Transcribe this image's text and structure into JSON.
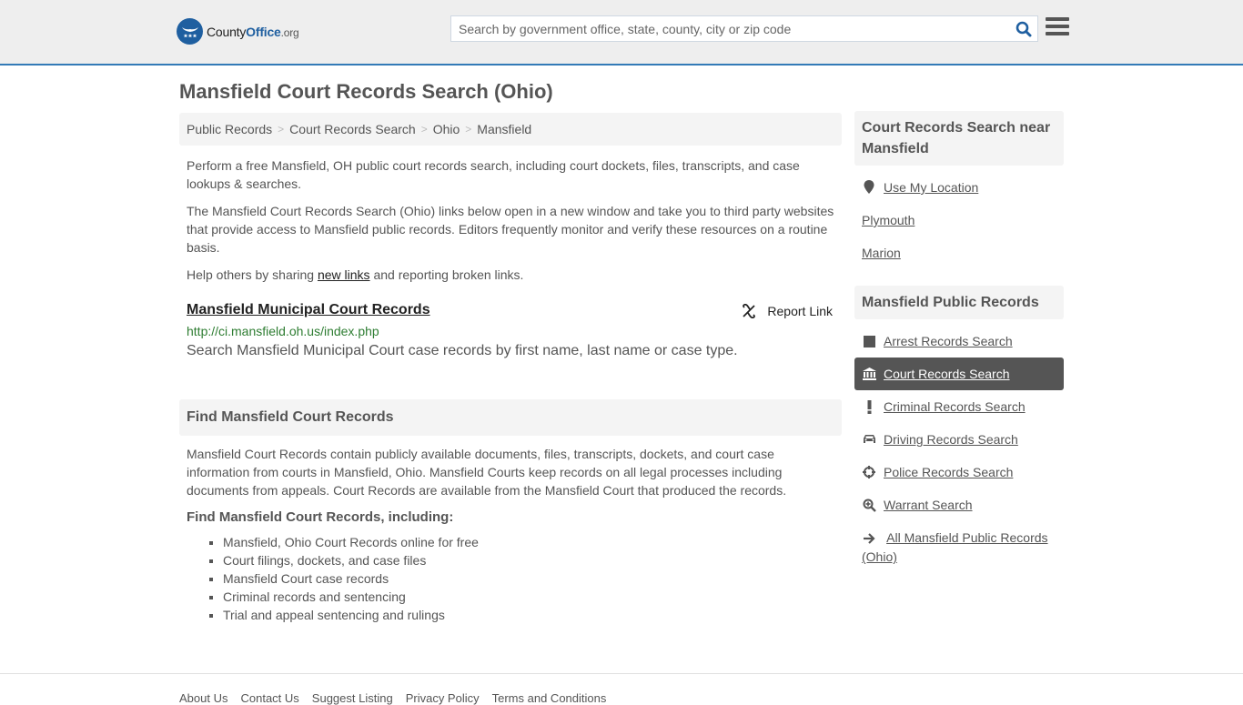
{
  "header": {
    "logo": {
      "name": "County",
      "name_bold": "Office",
      "tld": ".org"
    },
    "search": {
      "placeholder": "Search by government office, state, county, city or zip code",
      "value": ""
    },
    "colors": {
      "accent": "#337ab7",
      "brand": "#1f5fa0"
    }
  },
  "page": {
    "title": "Mansfield Court Records Search (Ohio)"
  },
  "breadcrumb": [
    {
      "label": "Public Records"
    },
    {
      "label": "Court Records Search"
    },
    {
      "label": "Ohio"
    },
    {
      "label": "Mansfield"
    }
  ],
  "intro": {
    "p1": "Perform a free Mansfield, OH public court records search, including court dockets, files, transcripts, and case lookups & searches.",
    "p2": "The Mansfield Court Records Search (Ohio) links below open in a new window and take you to third party websites that provide access to Mansfield public records. Editors frequently monitor and verify these resources on a routine basis.",
    "p3_before": "Help others by sharing ",
    "p3_link": "new links",
    "p3_after": " and reporting broken links."
  },
  "resources": [
    {
      "title": "Mansfield Municipal Court Records",
      "url": "http://ci.mansfield.oh.us/index.php",
      "description": "Search Mansfield Municipal Court case records by first name, last name or case type.",
      "report_label": "Report Link"
    }
  ],
  "find_section": {
    "heading": "Find Mansfield Court Records",
    "paragraph": "Mansfield Court Records contain publicly available documents, files, transcripts, dockets, and court case information from courts in Mansfield, Ohio. Mansfield Courts keep records on all legal processes including documents from appeals. Court Records are available from the Mansfield Court that produced the records.",
    "subheading": "Find Mansfield Court Records, including:",
    "items": [
      "Mansfield, Ohio Court Records online for free",
      "Court filings, dockets, and case files",
      "Mansfield Court case records",
      "Criminal records and sentencing",
      "Trial and appeal sentencing and rulings"
    ]
  },
  "sidebar": {
    "nearby": {
      "heading": "Court Records Search near Mansfield",
      "use_location": "Use My Location",
      "places": [
        "Plymouth",
        "Marion"
      ]
    },
    "public_records": {
      "heading": "Mansfield Public Records",
      "items": [
        {
          "label": "Arrest Records Search",
          "icon": "square-icon",
          "active": false
        },
        {
          "label": "Court Records Search",
          "icon": "courthouse-icon",
          "active": true
        },
        {
          "label": "Criminal Records Search",
          "icon": "exclamation-icon",
          "active": false
        },
        {
          "label": "Driving Records Search",
          "icon": "car-icon",
          "active": false
        },
        {
          "label": "Police Records Search",
          "icon": "crosshairs-icon",
          "active": false
        },
        {
          "label": "Warrant Search",
          "icon": "search-plus-icon",
          "active": false
        },
        {
          "label": "All Mansfield Public Records (Ohio)",
          "icon": "arrow-right-icon",
          "active": false
        }
      ]
    }
  },
  "footer": {
    "links": [
      "About Us",
      "Contact Us",
      "Suggest Listing",
      "Privacy Policy",
      "Terms and Conditions"
    ]
  }
}
